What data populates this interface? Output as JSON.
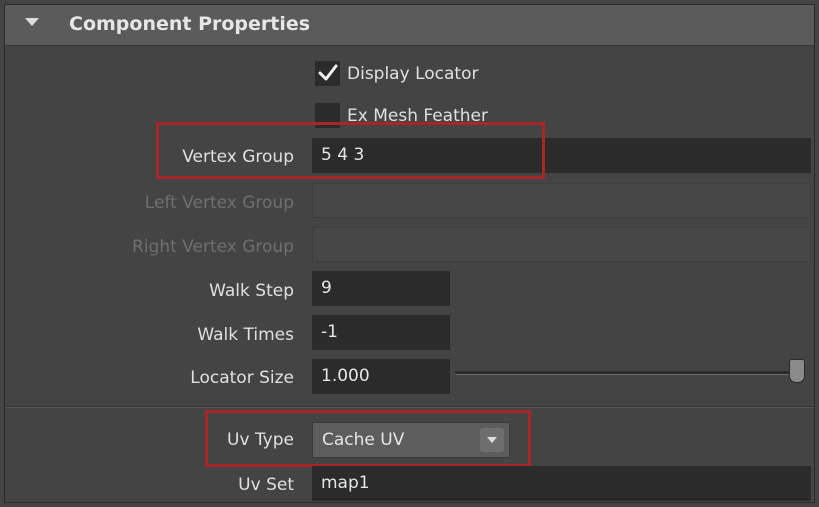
{
  "header": {
    "title": "Component Properties"
  },
  "checkboxes": {
    "display_locator": {
      "label": "Display Locator",
      "checked": true
    },
    "ex_mesh_feather": {
      "label": "Ex Mesh Feather",
      "checked": false
    }
  },
  "fields": {
    "vertex_group": {
      "label": "Vertex Group",
      "value": "5 4 3"
    },
    "left_vertex_group": {
      "label": "Left Vertex Group",
      "value": ""
    },
    "right_vertex_group": {
      "label": "Right Vertex Group",
      "value": ""
    },
    "walk_step": {
      "label": "Walk Step",
      "value": "9"
    },
    "walk_times": {
      "label": "Walk Times",
      "value": "-1"
    },
    "locator_size": {
      "label": "Locator Size",
      "value": "1.000",
      "slider_fraction": 1.0
    },
    "uv_type": {
      "label": "Uv Type",
      "selected": "Cache UV"
    },
    "uv_set": {
      "label": "Uv Set",
      "value": "map1"
    }
  },
  "colors": {
    "panel_bg": "#444444",
    "header_bg": "#5b5b5b",
    "field_bg": "#2b2b2b",
    "highlight": "#a8252a"
  }
}
